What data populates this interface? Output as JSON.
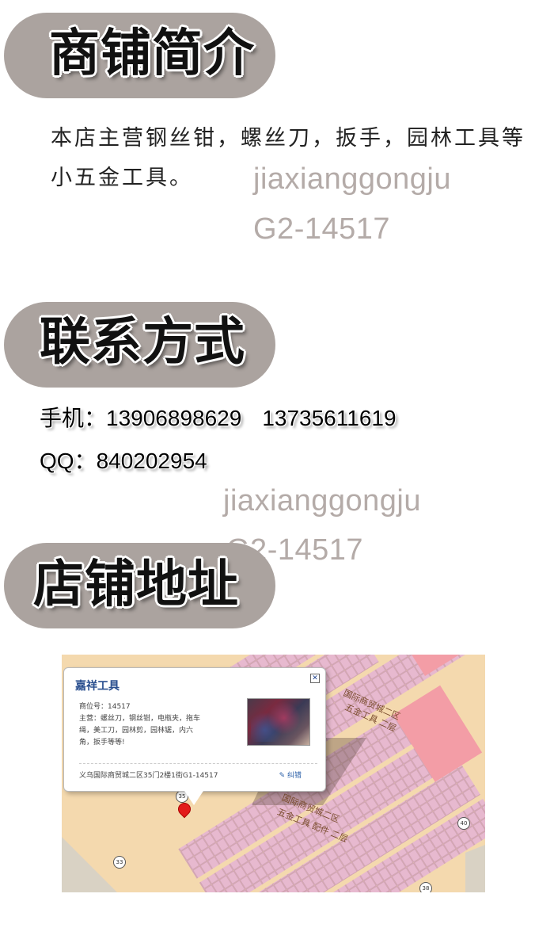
{
  "sections": {
    "intro": {
      "title": "商铺简介"
    },
    "contact": {
      "title": "联系方式"
    },
    "address": {
      "title": "店铺地址"
    }
  },
  "intro_text_line1": "本店主营钢丝钳，螺丝刀，扳手，园林工具等",
  "intro_text_line2": "小五金工具。",
  "watermark": {
    "line1": "jiaxianggongju",
    "line2": "G2-14517"
  },
  "contact": {
    "phone_label": "手机：",
    "phone1": "13906898629",
    "phone2": "13735611619",
    "qq_label": "QQ：",
    "qq": "840202954"
  },
  "map": {
    "popup": {
      "title": "嘉祥工具",
      "body": "商位号：14517\n主营：螺丝刀，钢丝钳，电瓶夹，拖车绳，美工刀，园林剪，园林锯，内六角，扳手等等!",
      "address": "义乌国际商贸城二区35门2楼1街G1-14517",
      "edit_label": "纠错",
      "close_icon": "close-icon"
    },
    "labels": {
      "zone1": "国际商贸城二区",
      "zone1_sub": "五金工具  二层",
      "zone2": "国际商贸城二区",
      "zone2_sub": "五金工具  配件  二层"
    },
    "road_badges": [
      "35",
      "33",
      "40",
      "38"
    ]
  },
  "colors": {
    "pill": "#aba39f",
    "watermark": "#b4aba8",
    "map_bg": "#f4d9ae",
    "stall": "#e7b9cf",
    "pink_block": "#f39da6"
  }
}
